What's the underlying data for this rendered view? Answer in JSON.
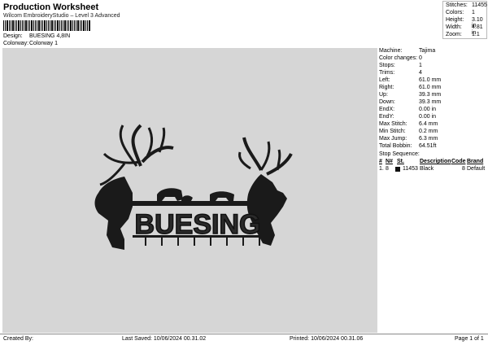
{
  "header": {
    "title": "Production Worksheet",
    "subtitle": "Wilcom EmbroideryStudio – Level 3 Advanced"
  },
  "meta": {
    "design_label": "Design:",
    "design_value": "BUESING 4,8IN",
    "colorway_label": "Colorway:",
    "colorway_value": "Colorway 1"
  },
  "stats": [
    {
      "label": "Stitches:",
      "value": "11455"
    },
    {
      "label": "Colors:",
      "value": "1"
    },
    {
      "label": "Height:",
      "value": "3.10 in"
    },
    {
      "label": "Width:",
      "value": "4.81 in"
    },
    {
      "label": "Zoom:",
      "value": "1:1"
    }
  ],
  "design": {
    "name_text": "BUESING",
    "thread_color": "#1a1a1a",
    "background": "#d6d6d6"
  },
  "info": [
    {
      "label": "Machine:",
      "value": "Tajima"
    },
    {
      "label": "Color changes:",
      "value": "0"
    },
    {
      "label": "Stops:",
      "value": "1"
    },
    {
      "label": "Trims:",
      "value": "4"
    },
    {
      "label": "Left:",
      "value": "61.0 mm"
    },
    {
      "label": "Right:",
      "value": "61.0 mm"
    },
    {
      "label": "Up:",
      "value": "39.3 mm"
    },
    {
      "label": "Down:",
      "value": "39.3 mm"
    },
    {
      "label": "EndX:",
      "value": "0.00 in"
    },
    {
      "label": "EndY:",
      "value": "0.00 in"
    },
    {
      "label": "Max Stitch:",
      "value": "6.4 mm"
    },
    {
      "label": "Min Stitch:",
      "value": "0.2 mm"
    },
    {
      "label": "Max Jump:",
      "value": "6.3 mm"
    },
    {
      "label": "Total Bobbin:",
      "value": "64.51ft"
    }
  ],
  "stop_sequence": {
    "title": "Stop Sequence:",
    "headers": {
      "num": "#",
      "n": "N#",
      "st": "St.",
      "desc": "Description",
      "code": "Code",
      "brand": "Brand"
    },
    "rows": [
      {
        "num": "1.",
        "n": "8",
        "st": "11453",
        "desc": "Black",
        "code": "8",
        "brand": "Default",
        "swatch": "#111111"
      }
    ]
  },
  "footer": {
    "created": "Created By:",
    "last_saved": "Last Saved: 10/06/2024 00.31.02",
    "printed": "Printed: 10/06/2024 00.31.06",
    "page": "Page 1 of 1"
  }
}
